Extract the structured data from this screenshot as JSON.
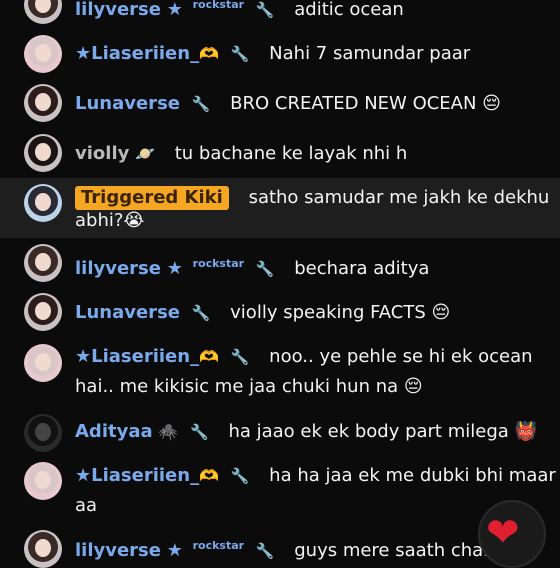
{
  "chat": {
    "messages": [
      {
        "name": "lilyverse",
        "star": "★",
        "tag": "rockstar",
        "text": "aditic ocean"
      },
      {
        "name": "★Liaseriien_",
        "suffix": "🫶",
        "text": "Nahi 7 samundar paar"
      },
      {
        "name": "Lunaverse",
        "text": "BRO CREATED NEW OCEAN 😔"
      },
      {
        "name": "violly",
        "suffix": "🪐",
        "text": "tu bachane ke layak nhi h"
      },
      {
        "name": "Triggered Kiki",
        "text": "satho samudar me jakh ke dekhu",
        "text2": "abhi?😭"
      },
      {
        "name": "lilyverse",
        "star": "★",
        "tag": "rockstar",
        "text": "bechara aditya"
      },
      {
        "name": "Lunaverse",
        "text": "violly speaking FACTS 😔"
      },
      {
        "name": "★Liaseriien_",
        "suffix": "🫶",
        "text": "noo.. ye pehle se hi ek ocean",
        "text2": "hai.. me kikisic me jaa chuki hun na 😔"
      },
      {
        "name": "Adityaa",
        "suffix": "🕷️",
        "text": "ha jaao ek ek body part milega 👹"
      },
      {
        "name": "★Liaseriien_",
        "suffix": "🫶",
        "text": "ha ha jaa ek me dubki bhi maar",
        "text2": "aa"
      },
      {
        "name": "lilyverse",
        "star": "★",
        "tag": "rockstar",
        "text": "guys mere saath chal"
      }
    ]
  },
  "icons": {
    "wrench": "🔧",
    "heart": "❤"
  }
}
